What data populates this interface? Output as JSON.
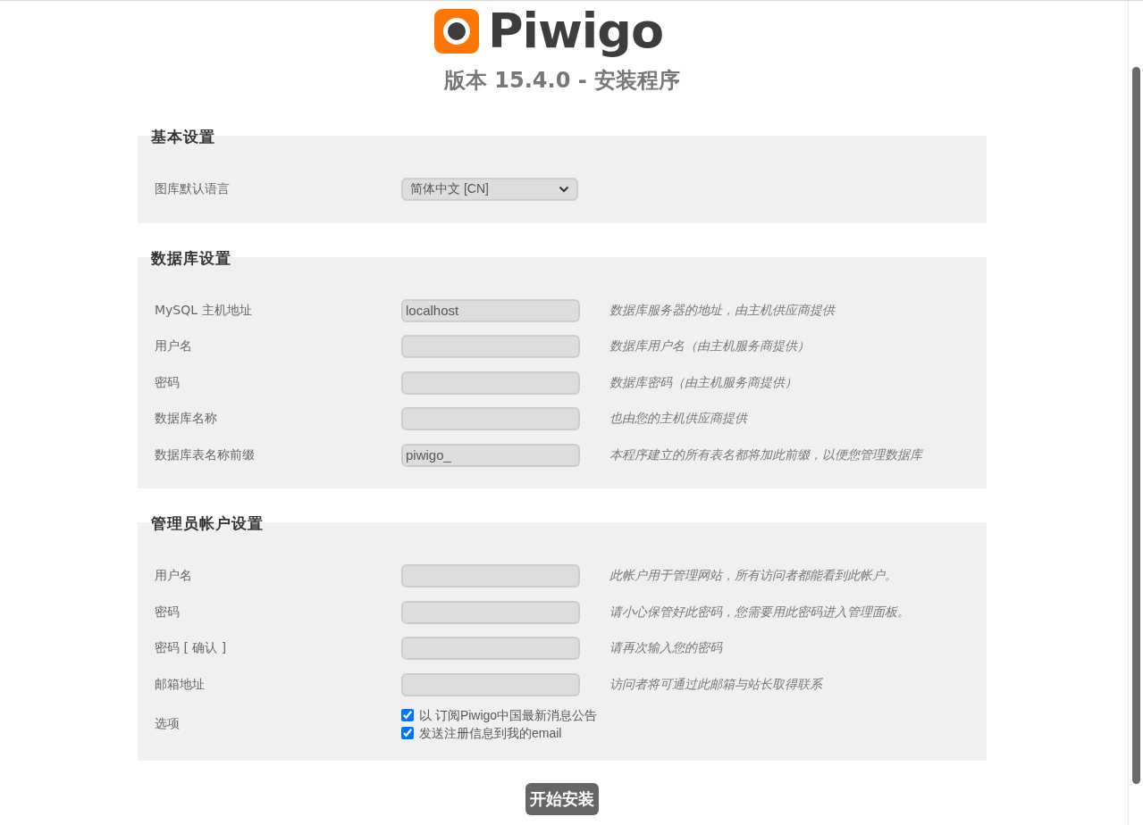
{
  "logo": {
    "text": "Piwigo"
  },
  "subtitle": "版本 15.4.0 - 安装程序",
  "sections": [
    {
      "title": "基本设置",
      "rows": [
        {
          "kind": "select",
          "label": "图库默认语言",
          "value": "简体中文 [CN]"
        }
      ]
    },
    {
      "title": "数据库设置",
      "rows": [
        {
          "kind": "text",
          "label": "MySQL 主机地址",
          "value": "localhost",
          "hint": "数据库服务器的地址，由主机供应商提供"
        },
        {
          "kind": "text",
          "label": "用户名",
          "hint": "数据库用户名（由主机服务商提供）"
        },
        {
          "kind": "password",
          "label": "密码",
          "hint": "数据库密码（由主机服务商提供）"
        },
        {
          "kind": "text",
          "label": "数据库名称",
          "hint": "也由您的主机供应商提供"
        },
        {
          "kind": "text",
          "label": "数据库表名称前缀",
          "value": "piwigo_",
          "hint": "本程序建立的所有表名都将加此前缀，以便您管理数据库"
        }
      ]
    },
    {
      "title": "管理员帐户设置",
      "rows": [
        {
          "kind": "text",
          "label": "用户名",
          "hint": "此帐户用于管理网站，所有访问者都能看到此帐户。"
        },
        {
          "kind": "password",
          "label": "密码",
          "hint": "请小心保管好此密码，您需要用此密码进入管理面板。"
        },
        {
          "kind": "password",
          "label": "密码 [ 确认 ]",
          "hint": "请再次输入您的密码"
        },
        {
          "kind": "text",
          "label": "邮箱地址",
          "hint": "访问者将可通过此邮箱与站长取得联系"
        },
        {
          "kind": "checkboxes",
          "label": "选项",
          "options": [
            {
              "label": "以 订阅Piwigo中国最新消息公告",
              "checked": true
            },
            {
              "label": "发送注册信息到我的email",
              "checked": true
            }
          ]
        }
      ]
    }
  ],
  "submit_button": "开始安装"
}
